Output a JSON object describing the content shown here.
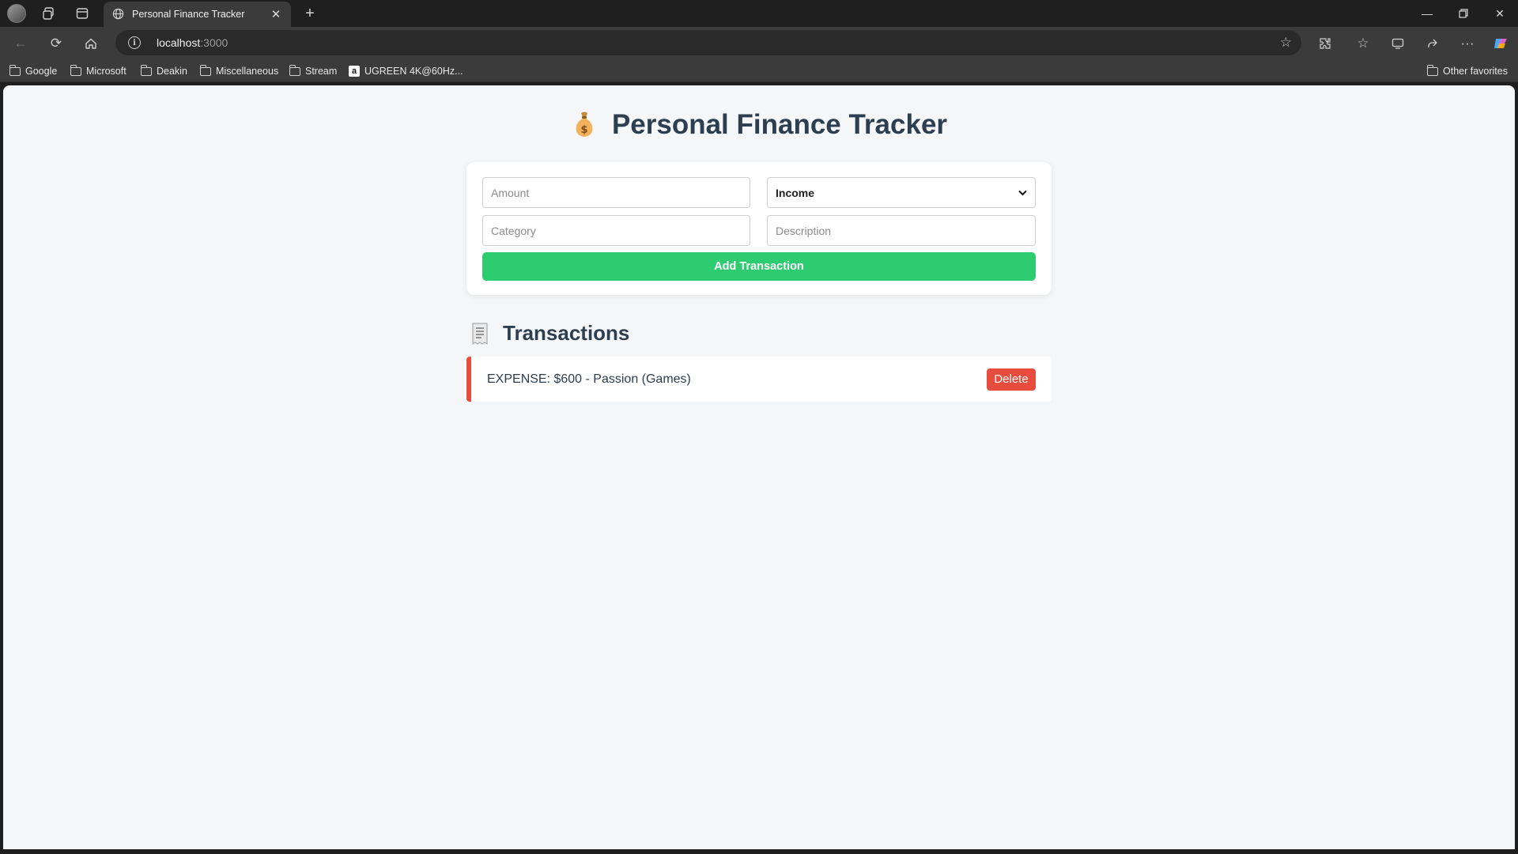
{
  "browser": {
    "tab": {
      "title": "Personal Finance Tracker",
      "icon": "globe-icon"
    },
    "address": {
      "host": "localhost",
      "port": ":3000"
    },
    "bookmarks": [
      {
        "label": "Google",
        "icon": "folder-icon"
      },
      {
        "label": "Microsoft",
        "icon": "folder-icon"
      },
      {
        "label": "Deakin",
        "icon": "folder-icon"
      },
      {
        "label": "Miscellaneous",
        "icon": "folder-icon"
      },
      {
        "label": "Stream",
        "icon": "folder-icon"
      },
      {
        "label": "UGREEN 4K@60Hz...",
        "icon": "amazon-icon"
      }
    ],
    "other_favorites": "Other favorites"
  },
  "app": {
    "title": "Personal Finance Tracker",
    "form": {
      "amount_placeholder": "Amount",
      "type_selected": "Income",
      "category_placeholder": "Category",
      "description_placeholder": "Description",
      "submit_label": "Add Transaction"
    },
    "transactions_heading": "Transactions",
    "transactions": [
      {
        "text": "EXPENSE: $600 - Passion (Games)",
        "type": "expense",
        "delete_label": "Delete"
      }
    ]
  },
  "colors": {
    "accent_green": "#2ecc71",
    "expense_red": "#e74c3c",
    "heading": "#2c3e50",
    "page_bg": "#f4f6f8"
  }
}
